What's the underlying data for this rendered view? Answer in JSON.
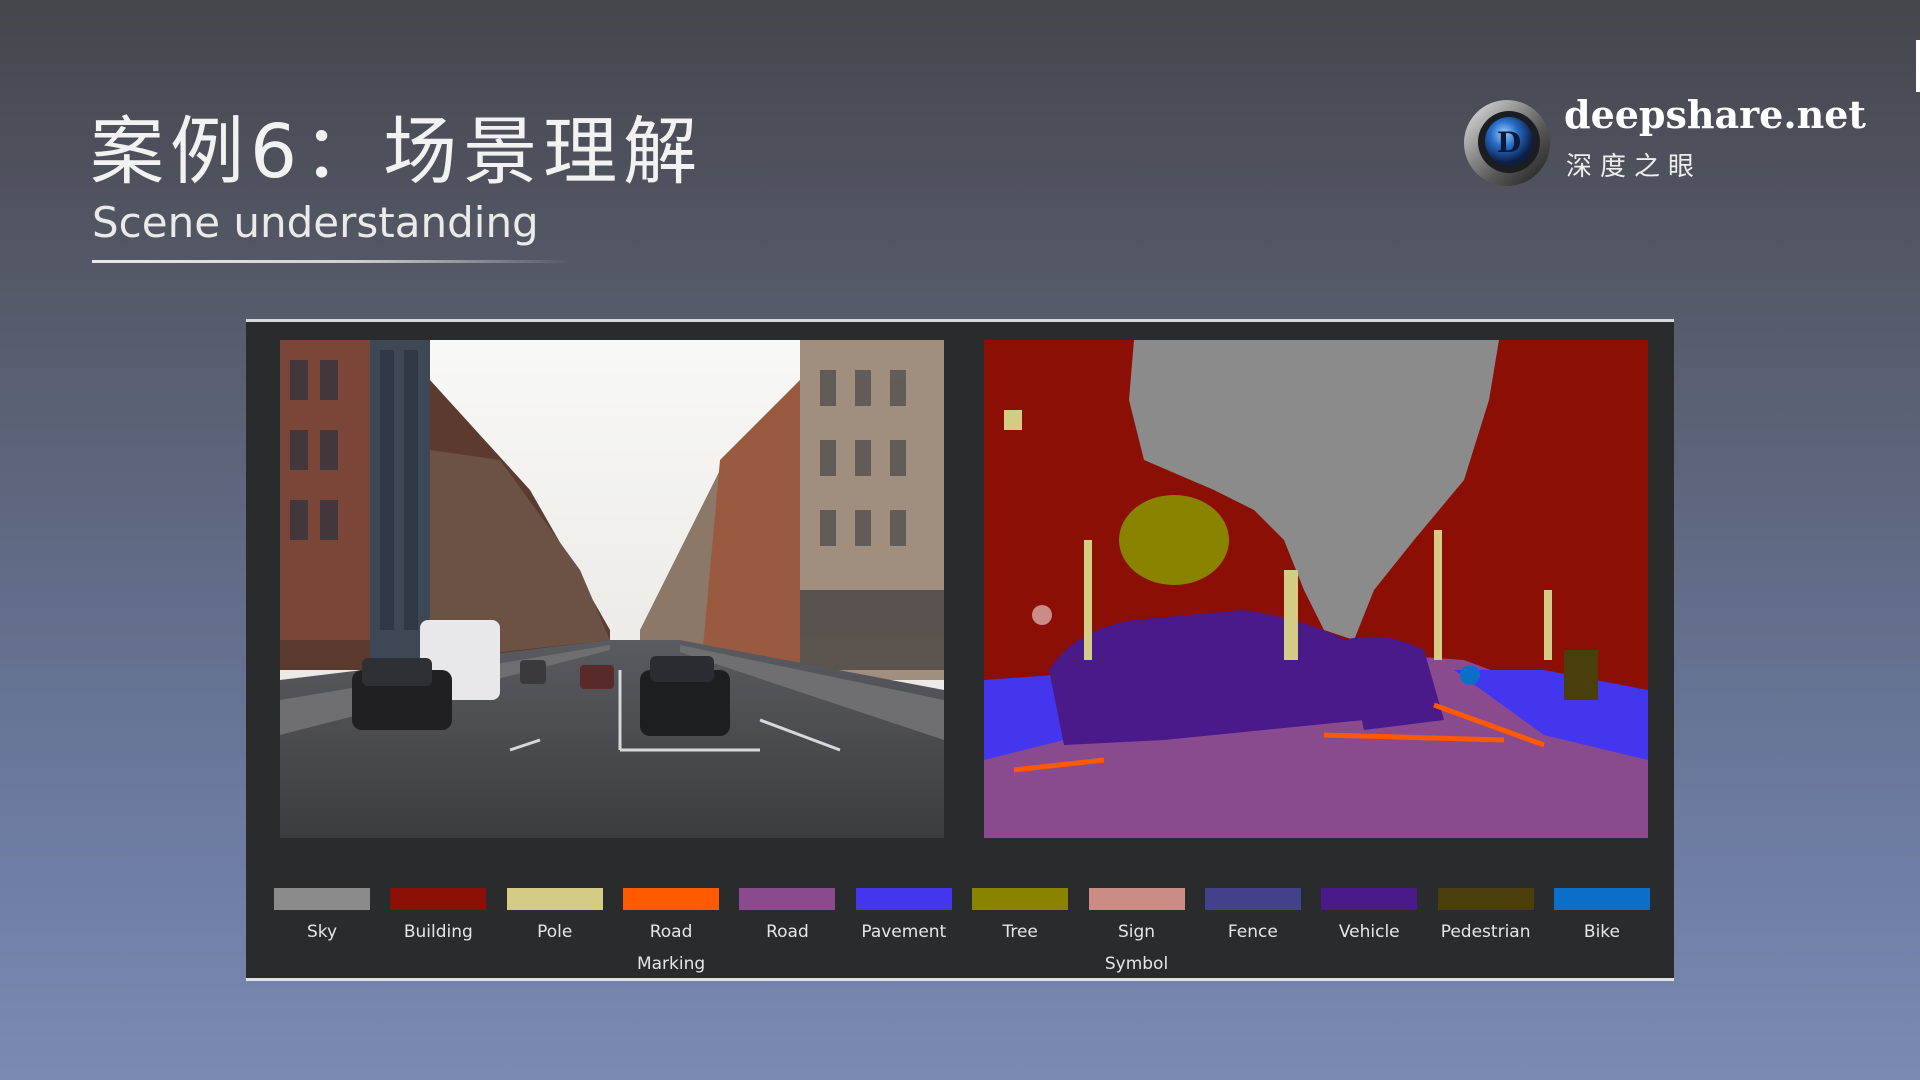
{
  "slide": {
    "title": "案例6：场景理解",
    "subtitle": "Scene understanding"
  },
  "brand": {
    "name": "deepshare.net",
    "tagline": "深度之眼",
    "logo_letter": "D"
  },
  "legend": [
    {
      "label": "Sky",
      "color": "#8b8b8b"
    },
    {
      "label": "Building",
      "color": "#8c0f06"
    },
    {
      "label": "Pole",
      "color": "#d4cc84"
    },
    {
      "label": "Road\nMarking",
      "color": "#ff5a00"
    },
    {
      "label": "Road",
      "color": "#8a4a8e"
    },
    {
      "label": "Pavement",
      "color": "#4436ee"
    },
    {
      "label": "Tree",
      "color": "#8a8300"
    },
    {
      "label": "Sign\nSymbol",
      "color": "#cc8c86"
    },
    {
      "label": "Fence",
      "color": "#41418c"
    },
    {
      "label": "Vehicle",
      "color": "#4a198a"
    },
    {
      "label": "Pedestrian",
      "color": "#4a3e0b"
    },
    {
      "label": "Bike",
      "color": "#0b6fc9"
    }
  ]
}
